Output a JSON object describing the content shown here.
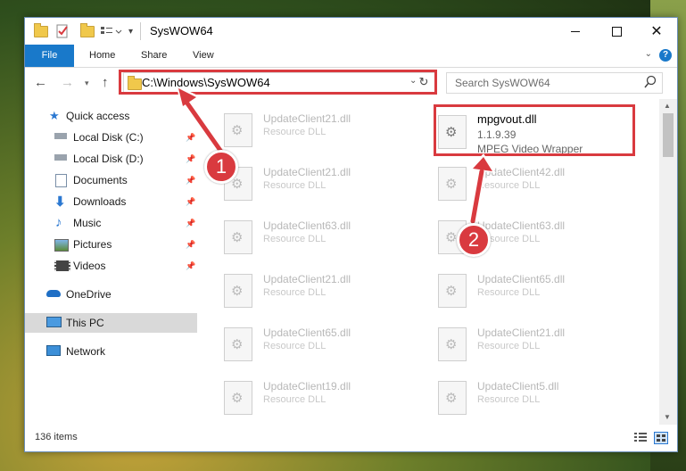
{
  "window": {
    "title": "SysWOW64",
    "controls": [
      "minimize-icon",
      "maximize-icon",
      "close-icon"
    ]
  },
  "ribbon": {
    "tabs": [
      {
        "label": "File",
        "active": true
      },
      {
        "label": "Home"
      },
      {
        "label": "Share"
      },
      {
        "label": "View"
      }
    ],
    "help_label": "?"
  },
  "address": {
    "path": "C:\\Windows\\SysWOW64",
    "search_placeholder": "Search SysWOW64"
  },
  "sidebar": {
    "items": [
      {
        "label": "Quick access",
        "icon": "star-icon",
        "pinned": false
      },
      {
        "label": "Local Disk (C:)",
        "icon": "disk-icon",
        "pinned": true
      },
      {
        "label": "Local Disk (D:)",
        "icon": "disk-icon",
        "pinned": true
      },
      {
        "label": "Documents",
        "icon": "documents-icon",
        "pinned": true
      },
      {
        "label": "Downloads",
        "icon": "download-icon",
        "pinned": true
      },
      {
        "label": "Music",
        "icon": "music-icon",
        "pinned": true
      },
      {
        "label": "Pictures",
        "icon": "pictures-icon",
        "pinned": true
      },
      {
        "label": "Videos",
        "icon": "videos-icon",
        "pinned": true
      },
      {
        "label": "OneDrive",
        "icon": "cloud-icon",
        "pinned": false
      },
      {
        "label": "This PC",
        "icon": "computer-icon",
        "pinned": false,
        "selected": true
      },
      {
        "label": "Network",
        "icon": "network-icon",
        "pinned": false
      }
    ]
  },
  "files": {
    "left_column": [
      {
        "name": "UpdateClient21.dll",
        "type": "Resource DLL"
      },
      {
        "name": "UpdateClient21.dll",
        "type": "Resource DLL"
      },
      {
        "name": "UpdateClient63.dll",
        "type": "Resource DLL"
      },
      {
        "name": "UpdateClient21.dll",
        "type": "Resource DLL"
      },
      {
        "name": "UpdateClient65.dll",
        "type": "Resource DLL"
      },
      {
        "name": "UpdateClient19.dll",
        "type": "Resource DLL"
      }
    ],
    "highlighted": {
      "name": "mpgvout.dll",
      "version": "1.1.9.39",
      "description": "MPEG Video Wrapper"
    },
    "right_column": [
      {
        "name": "UpdateClient42.dll",
        "type": "Resource DLL"
      },
      {
        "name": "UpdateClient63.dll",
        "type": "Resource DLL"
      },
      {
        "name": "UpdateClient65.dll",
        "type": "Resource DLL"
      },
      {
        "name": "UpdateClient21.dll",
        "type": "Resource DLL"
      },
      {
        "name": "UpdateClient5.dll",
        "type": "Resource DLL"
      }
    ]
  },
  "status": {
    "item_count": "136 items"
  },
  "annotations": {
    "step1": "1",
    "step2": "2",
    "color": "#d93a3f"
  }
}
